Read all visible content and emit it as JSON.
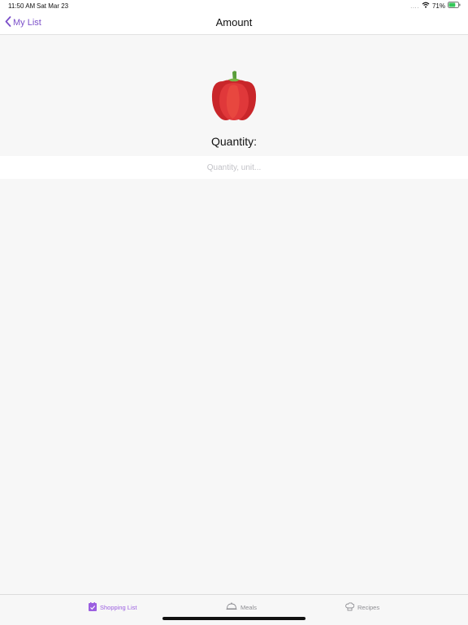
{
  "status_bar": {
    "time": "11:50 AM",
    "date": "Sat Mar 23",
    "signal": "....",
    "battery_percent": "71%",
    "battery_level": 0.71
  },
  "nav": {
    "back_label": "My List",
    "title": "Amount"
  },
  "item": {
    "icon": "bell-pepper-icon"
  },
  "quantity": {
    "label": "Quantity:",
    "placeholder": "Quantity, unit...",
    "value": ""
  },
  "tabs": [
    {
      "label": "Shopping List",
      "icon": "shopping-list-icon",
      "active": true
    },
    {
      "label": "Meals",
      "icon": "cloche-icon",
      "active": false
    },
    {
      "label": "Recipes",
      "icon": "chef-hat-icon",
      "active": false
    }
  ],
  "colors": {
    "accent": "#7b4fc9",
    "active_tab": "#9b5fe0",
    "inactive_tab": "#8e8e93",
    "battery_fill": "#34c759"
  }
}
